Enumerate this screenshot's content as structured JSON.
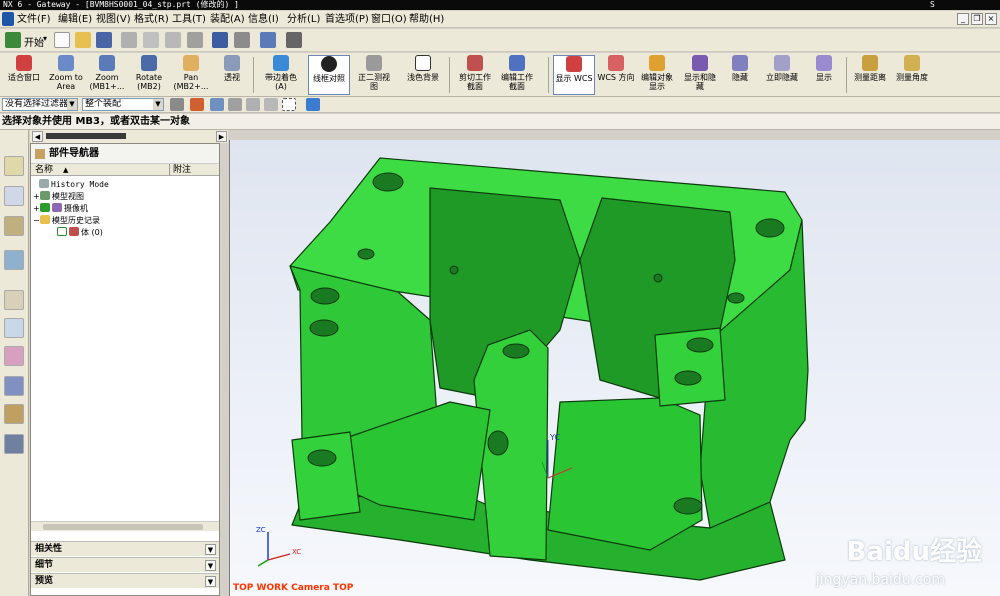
{
  "window": {
    "title": "NX 6 - Gateway - [BVM8HS0001_04_stp.prt  (修改的) ]",
    "right_glyph": "S"
  },
  "menu": [
    {
      "label": "文件(F)"
    },
    {
      "label": "编辑(E)"
    },
    {
      "label": "视图(V)"
    },
    {
      "label": "格式(R)"
    },
    {
      "label": "工具(T)"
    },
    {
      "label": "装配(A)"
    },
    {
      "label": "信息(I)"
    },
    {
      "label": "分析(L)"
    },
    {
      "label": "首选项(P)"
    },
    {
      "label": "窗口(O)"
    },
    {
      "label": "帮助(H)"
    }
  ],
  "toolbar_standard": {
    "start_label": "开始",
    "start_arrow": "▾"
  },
  "toolbar_view": [
    {
      "label": "适合窗口",
      "icon": "fit-icon"
    },
    {
      "label": "Zoom to\nArea",
      "icon": "zoom-area-icon"
    },
    {
      "label": "Zoom\n(MB1+...",
      "icon": "zoom-icon"
    },
    {
      "label": "Rotate\n(MB2)",
      "icon": "rotate-icon"
    },
    {
      "label": "Pan\n(MB2+...",
      "icon": "pan-icon"
    },
    {
      "label": "透视",
      "icon": "perspective-icon"
    },
    {
      "label": "带边着色\n(A)",
      "icon": "shaded-edges-icon"
    },
    {
      "label": "线框对照",
      "icon": "wireframe-icon"
    },
    {
      "label": "正二测视\n图",
      "icon": "dimetric-icon"
    },
    {
      "label": "浅色背景",
      "icon": "background-icon"
    },
    {
      "label": "剪切工作\n截面",
      "icon": "clip-section-icon"
    },
    {
      "label": "编辑工作\n截面",
      "icon": "edit-section-icon"
    },
    {
      "label": "显示 WCS",
      "icon": "wcs-display-icon"
    },
    {
      "label": "WCS 方向",
      "icon": "wcs-orient-icon"
    },
    {
      "label": "编辑对象\n显示",
      "icon": "edit-object-icon"
    },
    {
      "label": "显示和隐\n藏",
      "icon": "show-hide-icon"
    },
    {
      "label": "隐藏",
      "icon": "hide-icon"
    },
    {
      "label": "立即隐藏",
      "icon": "immediate-hide-icon"
    },
    {
      "label": "显示",
      "icon": "show-icon"
    },
    {
      "label": "测量距离",
      "icon": "measure-distance-icon"
    },
    {
      "label": "测量角度",
      "icon": "measure-angle-icon"
    }
  ],
  "selection_bar": {
    "filter": "没有选择过滤器",
    "scope": "整个装配"
  },
  "cue_line": "选择对象并使用 MB3，或者双击某一对象",
  "part_navigator": {
    "title": "部件导航器",
    "columns": [
      "名称",
      "附注"
    ],
    "tree": [
      {
        "label": "History Mode"
      },
      {
        "label": "模型视图"
      },
      {
        "label": "摄像机"
      },
      {
        "label": "模型历史记录"
      },
      {
        "label": "体 (0)"
      }
    ],
    "panels": [
      "相关性",
      "细节",
      "预览"
    ]
  },
  "viewport": {
    "status": "TOP WORK Camera TOP",
    "model_color": "#2ecc3a",
    "edge_color": "#0b3a0b",
    "axis_labels": {
      "x": "XC",
      "y": "YC",
      "z": "ZC"
    }
  },
  "watermark": {
    "brand": "Baidu经验",
    "url": "jingyan.baidu.com"
  }
}
